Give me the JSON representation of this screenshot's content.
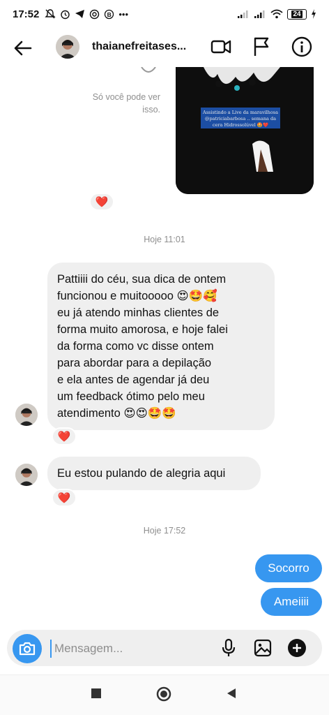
{
  "status_bar": {
    "time": "17:52",
    "battery": "24"
  },
  "header": {
    "username": "thaianefreitases..."
  },
  "story": {
    "caption_text": "Assistindo a Live da maravilhosa @patriciabarbosa .. semana da cera Hidrossolúvel 🤩❤️",
    "only_you_text": "Só você pode ver isso.",
    "reaction": "❤️"
  },
  "messages": {
    "timestamp_1": "Hoje 11:01",
    "msg1_lines": [
      "Pattiiii do céu, sua dica de ontem",
      "funcionou e muitooooo 😍🤩🥰",
      "eu já atendo minhas clientes de",
      "forma muito amorosa,  e hoje falei",
      "da forma como vc disse ontem",
      "para abordar para a depilação",
      "e ela antes de agendar já deu",
      "um feedback ótimo pelo meu",
      "atendimento 😍😍🤩🤩"
    ],
    "msg1_reaction": "❤️",
    "msg2": "Eu estou pulando de alegria aqui",
    "msg2_reaction": "❤️",
    "timestamp_2": "Hoje 17:52",
    "out1": "Socorro",
    "out2": "Ameiiii"
  },
  "composer": {
    "placeholder": "Mensagem..."
  },
  "colors": {
    "accent": "#3797f0",
    "incoming_bubble": "#efefef",
    "heart": "#e0182d"
  },
  "icons": [
    "back-arrow-icon",
    "video-call-icon",
    "flag-icon",
    "info-icon",
    "camera-icon",
    "microphone-icon",
    "gallery-icon",
    "plus-icon",
    "square-nav-icon",
    "circle-nav-icon",
    "triangle-back-icon"
  ]
}
